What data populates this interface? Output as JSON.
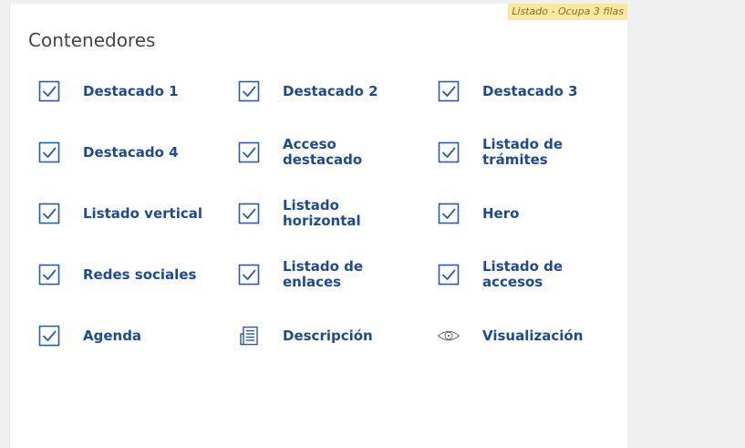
{
  "tag": "Listado - Ocupa 3 filas",
  "title": "Contenedores",
  "colors": {
    "accent": "#1e4b8f",
    "icon": "#2a5ba5",
    "tag_bg": "#fbe8a0"
  },
  "items": [
    {
      "label": "Destacado 1",
      "icon": "checkbox-checked-icon"
    },
    {
      "label": "Destacado 2",
      "icon": "checkbox-checked-icon"
    },
    {
      "label": "Destacado 3",
      "icon": "checkbox-checked-icon"
    },
    {
      "label": "Destacado 4",
      "icon": "checkbox-checked-icon"
    },
    {
      "label": "Acceso destacado",
      "icon": "checkbox-checked-icon"
    },
    {
      "label": "Listado de trámites",
      "icon": "checkbox-checked-icon"
    },
    {
      "label": "Listado vertical",
      "icon": "checkbox-checked-icon"
    },
    {
      "label": "Listado horizontal",
      "icon": "checkbox-checked-icon"
    },
    {
      "label": "Hero",
      "icon": "checkbox-checked-icon"
    },
    {
      "label": "Redes sociales",
      "icon": "checkbox-checked-icon"
    },
    {
      "label": "Listado de enlaces",
      "icon": "checkbox-checked-icon"
    },
    {
      "label": "Listado de accesos",
      "icon": "checkbox-checked-icon"
    },
    {
      "label": "Agenda",
      "icon": "checkbox-checked-icon"
    },
    {
      "label": "Descripción",
      "icon": "document-icon"
    },
    {
      "label": "Visualización",
      "icon": "eye-icon"
    }
  ]
}
